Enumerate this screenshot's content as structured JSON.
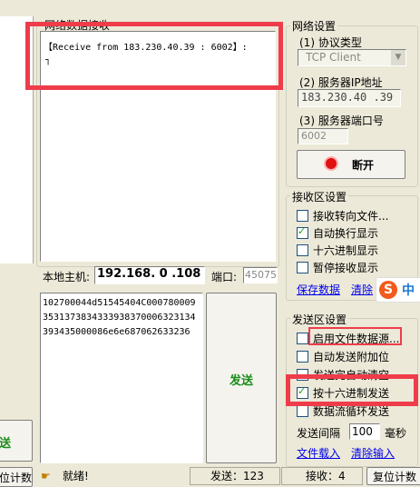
{
  "receive_panel": {
    "title": "网络数据接收",
    "lines": [
      "【Receive from 183.230.40.39 : 6002】:",
      "┐"
    ]
  },
  "network": {
    "group_title": "网络设置",
    "protocol_label": "(1) 协议类型",
    "protocol_value": "TCP Client",
    "server_ip_label": "(2) 服务器IP地址",
    "server_ip_value": "183.230.40 .39",
    "server_port_label": "(3) 服务器端口号",
    "server_port_value": "6002",
    "disconnect_label": "断开"
  },
  "receive_settings": {
    "group_title": "接收区设置",
    "options": [
      {
        "label": "接收转向文件...",
        "checked": false
      },
      {
        "label": "自动换行显示",
        "checked": true
      },
      {
        "label": "十六进制显示",
        "checked": false
      },
      {
        "label": "暂停接收显示",
        "checked": false
      }
    ],
    "save_link": "保存数据",
    "clear_link": "清除"
  },
  "local_host": {
    "label": "本地主机:",
    "ip": "192.168. 0 .108",
    "port_label": "端口:",
    "port_value": "45075"
  },
  "send_text": "102700044d51545404C0007800093531373834333938370006323134393435000086e6e687062633236",
  "send_button_label": "发送",
  "send_settings": {
    "group_title": "发送区设置",
    "options": [
      {
        "label": "启用文件数据源...",
        "checked": false
      },
      {
        "label": "自动发送附加位",
        "checked": false
      },
      {
        "label": "发送完自动清空",
        "checked": false
      },
      {
        "label": "按十六进制发送",
        "checked": true
      },
      {
        "label": "数据流循环发送",
        "checked": false
      }
    ],
    "interval_label": "发送间隔",
    "interval_value": "100",
    "interval_unit": "毫秒",
    "load_file_link": "文件载入",
    "clear_input_link": "清除输入"
  },
  "left_edge": {
    "button_fragment": "送",
    "reset_fragment": "位计数"
  },
  "status_bar": {
    "ready_text": "就绪!",
    "sent": "发送：123",
    "received": "接收：4",
    "reset": "复位计数"
  },
  "ime_badge": {
    "logo": "S",
    "text": "中"
  },
  "colors": {
    "annotation_red": "#ef3c4a",
    "send_green": "#1a8c1a",
    "link_blue": "#0000ee"
  }
}
